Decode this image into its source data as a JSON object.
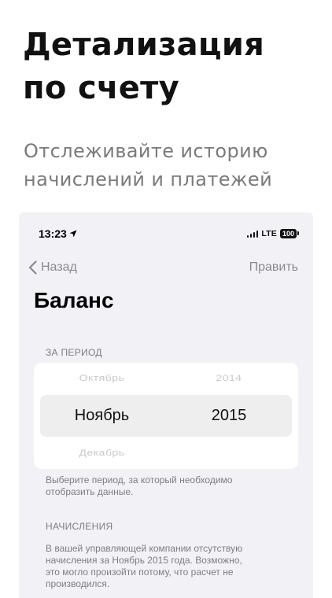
{
  "promo": {
    "title_line1": "Детализация",
    "title_line2": "по счету",
    "subtitle_line1": "Отслеживайте историю",
    "subtitle_line2": "начислений и платежей"
  },
  "status_bar": {
    "time": "13:23",
    "network": "LTE",
    "battery": "100",
    "location_icon": "location-arrow-icon"
  },
  "nav": {
    "back_label": "Назад",
    "edit_label": "Править",
    "back_icon": "chevron-left-icon"
  },
  "screen": {
    "title": "Баланс"
  },
  "period": {
    "header": "ЗА ПЕРИОД",
    "month_prev": "Октябрь",
    "month_selected": "Ноябрь",
    "month_next": "Декабрь",
    "year_prev": "2014",
    "year_selected": "2015",
    "footer_line1": "Выберите период, за который необходимо",
    "footer_line2": "отобразить данные."
  },
  "charges": {
    "header": "НАЧИСЛЕНИЯ",
    "line1": "В вашей управляющей компании отсутствую",
    "line2": "начисления за Ноябрь 2015 года. Возможно,",
    "line3": "это могло произойти потому, что расчет не",
    "line4": "производился."
  }
}
